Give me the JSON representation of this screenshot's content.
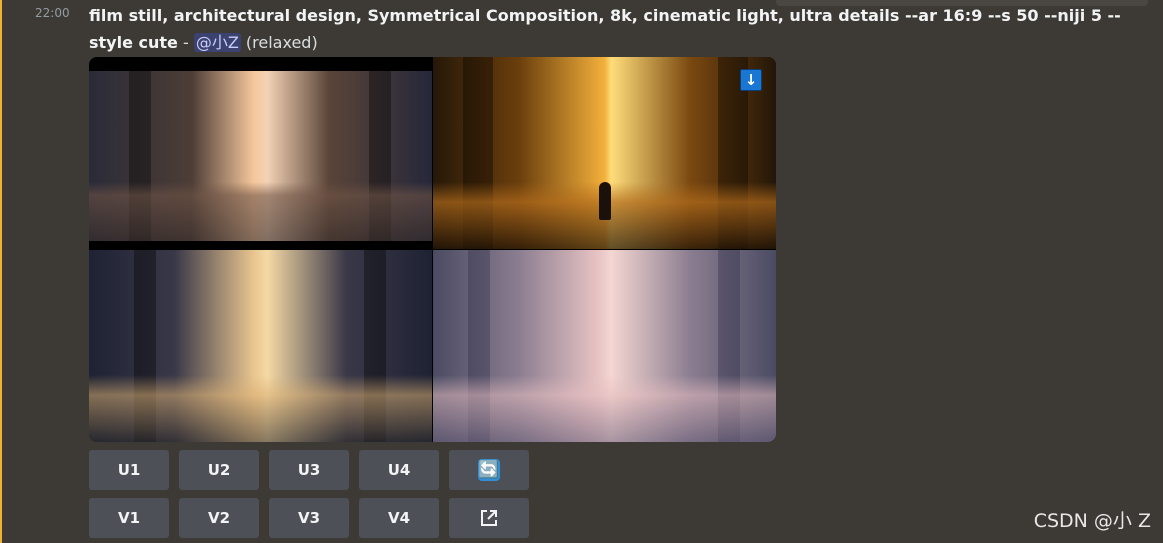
{
  "message": {
    "timestamp": "22:00",
    "prompt_line1": "film still, architectural design, Symmetrical Composition, 8k, cinematic light, ultra details --ar 16:9 --s 50 --niji 5 --",
    "prompt_line2": "style cute",
    "separator": " - ",
    "mention": "@小Z",
    "mode": "(relaxed)"
  },
  "image_grid": {
    "download_icon": "download-arrow-icon",
    "download_glyph": "↓"
  },
  "upscale_buttons": [
    "U1",
    "U2",
    "U3",
    "U4"
  ],
  "variation_buttons": [
    "V1",
    "V2",
    "V3",
    "V4"
  ],
  "reroll_button": {
    "icon": "refresh-icon",
    "glyph": "🔄"
  },
  "web_button": {
    "icon": "external-link-icon"
  },
  "watermark": "CSDN @小 Z",
  "colors": {
    "background": "#3d3a35",
    "button": "#4e5058",
    "mention_bg": "#3c4270",
    "accent_rail": "#f0b232"
  }
}
